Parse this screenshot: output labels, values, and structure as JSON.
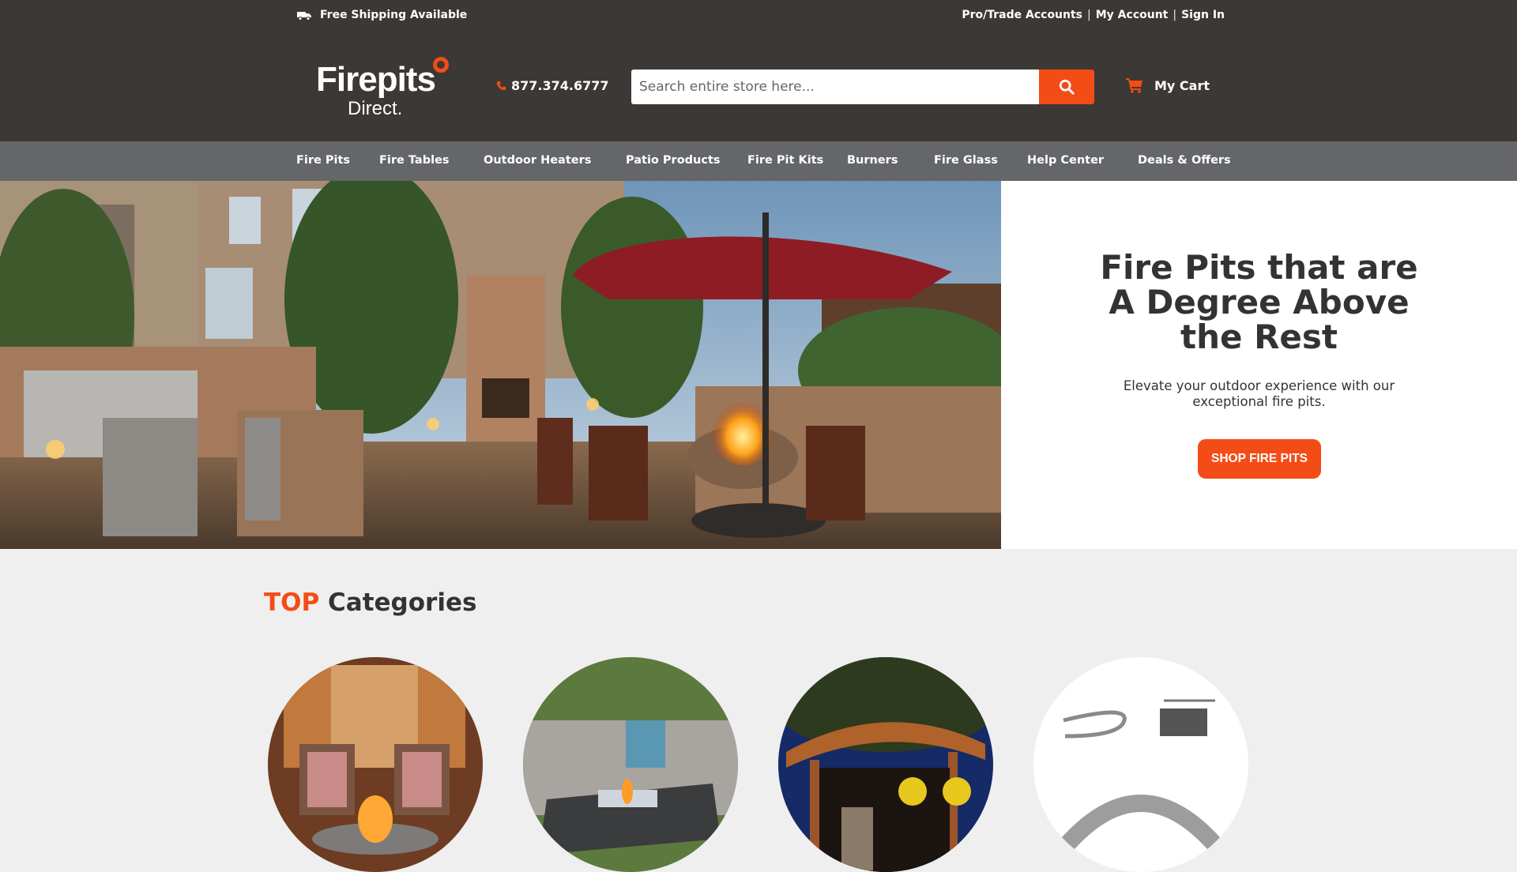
{
  "topbar": {
    "shipping_icon": "truck-icon",
    "shipping_text": "Free Shipping Available",
    "links": [
      "Pro/Trade Accounts",
      "My Account",
      "Sign In"
    ],
    "separator": "|"
  },
  "header": {
    "logo_line1": "Firepits",
    "logo_line2": "Direct.",
    "phone_icon": "phone-icon",
    "phone": "877.374.6777",
    "search_placeholder": "Search entire store here...",
    "search_icon": "search-icon",
    "cart_icon": "cart-icon",
    "cart_label": "My Cart"
  },
  "nav": {
    "items": [
      "Fire Pits",
      "Fire Tables",
      "Outdoor Heaters",
      "Patio Products",
      "Fire Pit Kits",
      "Burners",
      "Fire Glass",
      "Help Center",
      "Deals & Offers"
    ]
  },
  "hero": {
    "title": "Fire Pits that are A Degree Above the Rest",
    "subtitle": "Elevate your outdoor experience with our exceptional fire pits.",
    "button_label": "SHOP FIRE PITS"
  },
  "categories": {
    "heading_accent": "TOP",
    "heading_rest": "Categories",
    "items": [
      {
        "image": "fire-pits-category-image"
      },
      {
        "image": "fire-tables-category-image"
      },
      {
        "image": "patio-products-category-image"
      },
      {
        "image": "fire-pit-kits-category-image"
      }
    ]
  },
  "colors": {
    "accent": "#f44c17",
    "header_bg": "#3b3835",
    "nav_bg": "#646669",
    "page_bg": "#efefef",
    "text_dark": "#333333"
  }
}
